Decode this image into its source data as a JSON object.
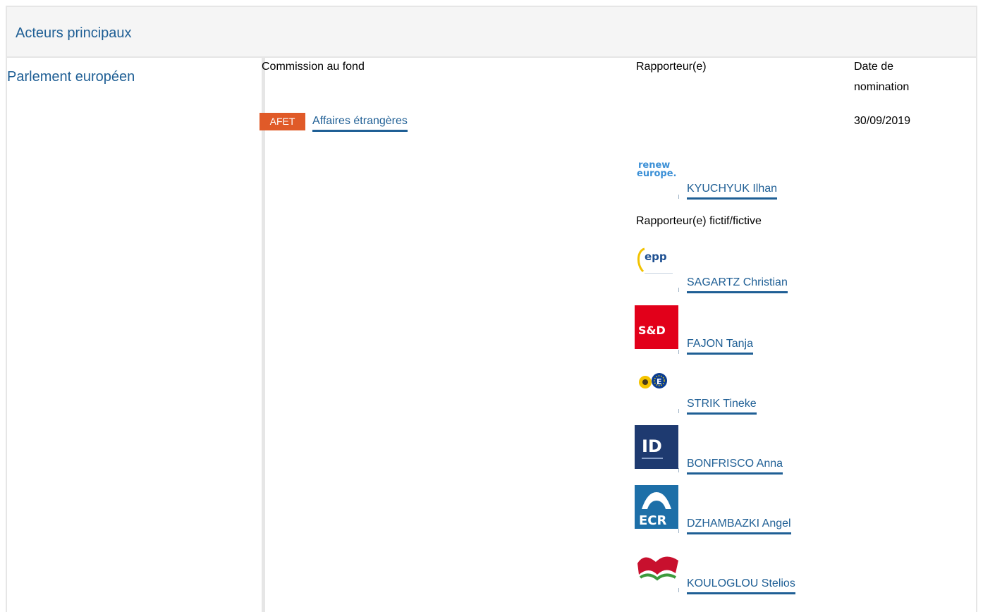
{
  "section": {
    "title": "Acteurs principaux"
  },
  "institution": {
    "label": "Parlement européen"
  },
  "columns": {
    "committee": "Commission au fond",
    "rapporteur": "Rapporteur(e)",
    "date": "Date de nomination",
    "date_line1": "Date de",
    "date_line2": "nomination"
  },
  "committee": {
    "code": "AFET",
    "name": "Affaires étrangères",
    "date": "30/09/2019"
  },
  "rapporteur": {
    "group_icon": "renew-europe-logo",
    "group_logo_text_1": "renew",
    "group_logo_text_2": "europe.",
    "name": "KYUCHYUK Ilhan"
  },
  "shadow_label": "Rapporteur(e) fictif/fictive",
  "shadows": [
    {
      "group_icon": "epp-logo",
      "logo_text": "epp",
      "name": "SAGARTZ Christian"
    },
    {
      "group_icon": "s-and-d-logo",
      "logo_text": "S&D",
      "name": "FAJON Tanja"
    },
    {
      "group_icon": "greens-efa-logo",
      "name": "STRIK Tineke"
    },
    {
      "group_icon": "identity-democracy-logo",
      "logo_text": "ID",
      "name": "BONFRISCO Anna"
    },
    {
      "group_icon": "ecr-logo",
      "logo_text": "ECR",
      "name": "DZHAMBAZKI Angel"
    },
    {
      "group_icon": "gue-ngl-logo",
      "name": "KOULOGLOU Stelios"
    }
  ],
  "colors": {
    "link": "#1f5f95",
    "badge": "#e05a28",
    "border": "#e6e6e6"
  }
}
